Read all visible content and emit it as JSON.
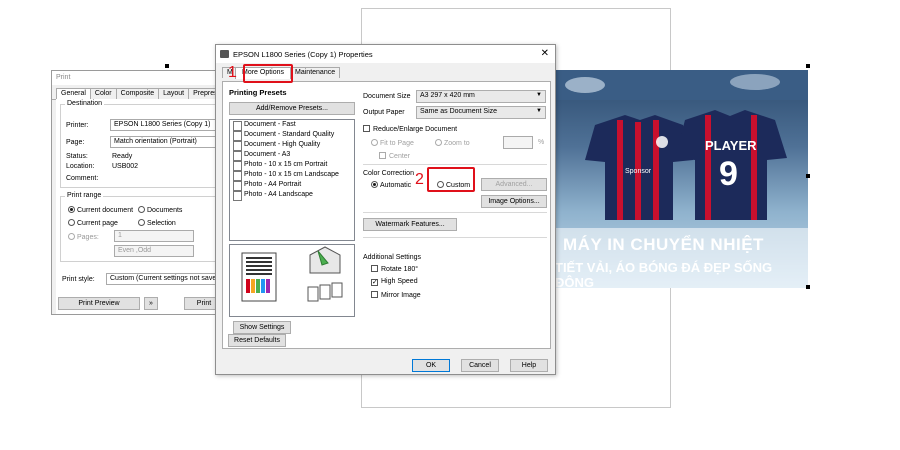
{
  "print_dialog": {
    "title": "Print",
    "tabs": [
      "General",
      "Color",
      "Composite",
      "Layout",
      "Prepress"
    ],
    "destination_label": "Destination",
    "printer_label": "Printer:",
    "printer_value": "EPSON L1800 Series (Copy 1)",
    "page_label": "Page:",
    "page_value": "Match orientation (Portrait)",
    "status_label": "Status:",
    "status_value": "Ready",
    "location_label": "Location:",
    "location_value": "USB002",
    "comment_label": "Comment:",
    "print_range_label": "Print range",
    "current_document": "Current document",
    "documents": "Documents",
    "current_page": "Current page",
    "selection": "Selection",
    "pages_label": "Pages:",
    "pages_value": "1",
    "even_odd": "Even ,Odd",
    "print_style_label": "Print style:",
    "print_style_value": "Custom (Current settings not saved)",
    "print_preview_btn": "Print Preview",
    "print_btn": "Print"
  },
  "epson_dialog": {
    "title": "EPSON L1800 Series (Copy 1) Properties",
    "close_glyph": "✕",
    "tabs": {
      "main_partial": "M",
      "more_options": "More Options",
      "maintenance": "Maintenance"
    },
    "printing_presets_label": "Printing Presets",
    "add_remove_presets_btn": "Add/Remove Presets...",
    "presets": [
      "Document - Fast",
      "Document - Standard Quality",
      "Document - High Quality",
      "Document - A3",
      "Photo - 10 x 15 cm Portrait",
      "Photo - 10 x 15 cm Landscape",
      "Photo - A4 Portrait",
      "Photo - A4 Landscape"
    ],
    "document_size_label": "Document Size",
    "document_size_value": "A3 297 x 420 mm",
    "output_paper_label": "Output Paper",
    "output_paper_value": "Same as Document Size",
    "reduce_enlarge_label": "Reduce/Enlarge Document",
    "fit_to_page": "Fit to Page",
    "zoom_to": "Zoom to",
    "percent": "%",
    "center": "Center",
    "color_correction_label": "Color Correction",
    "automatic": "Automatic",
    "custom": "Custom",
    "advanced_btn": "Advanced...",
    "image_options_btn": "Image Options...",
    "watermark_btn": "Watermark Features...",
    "additional_settings_label": "Additional Settings",
    "rotate_180": "Rotate 180°",
    "high_speed": "High Speed",
    "mirror_image": "Mirror Image",
    "show_settings_btn": "Show Settings",
    "reset_defaults_btn": "Reset Defaults",
    "ok_btn": "OK",
    "cancel_btn": "Cancel",
    "help_btn": "Help"
  },
  "annotations": {
    "step1": "1",
    "step2": "2"
  },
  "banner": {
    "jersey_player": "PLAYER",
    "jersey_number": "9",
    "jersey_sponsor": "Sponsor",
    "title_line1": "MÁY IN CHUYỂN NHIỆT",
    "title_line2": "TIẾT VẢI, ÁO BÓNG ĐÁ ĐẸP SỐNG ĐỘNG"
  },
  "colors": {
    "annotation_red": "#e0101a",
    "jersey_navy": "#1c2a5a",
    "jersey_red": "#c8102e"
  }
}
